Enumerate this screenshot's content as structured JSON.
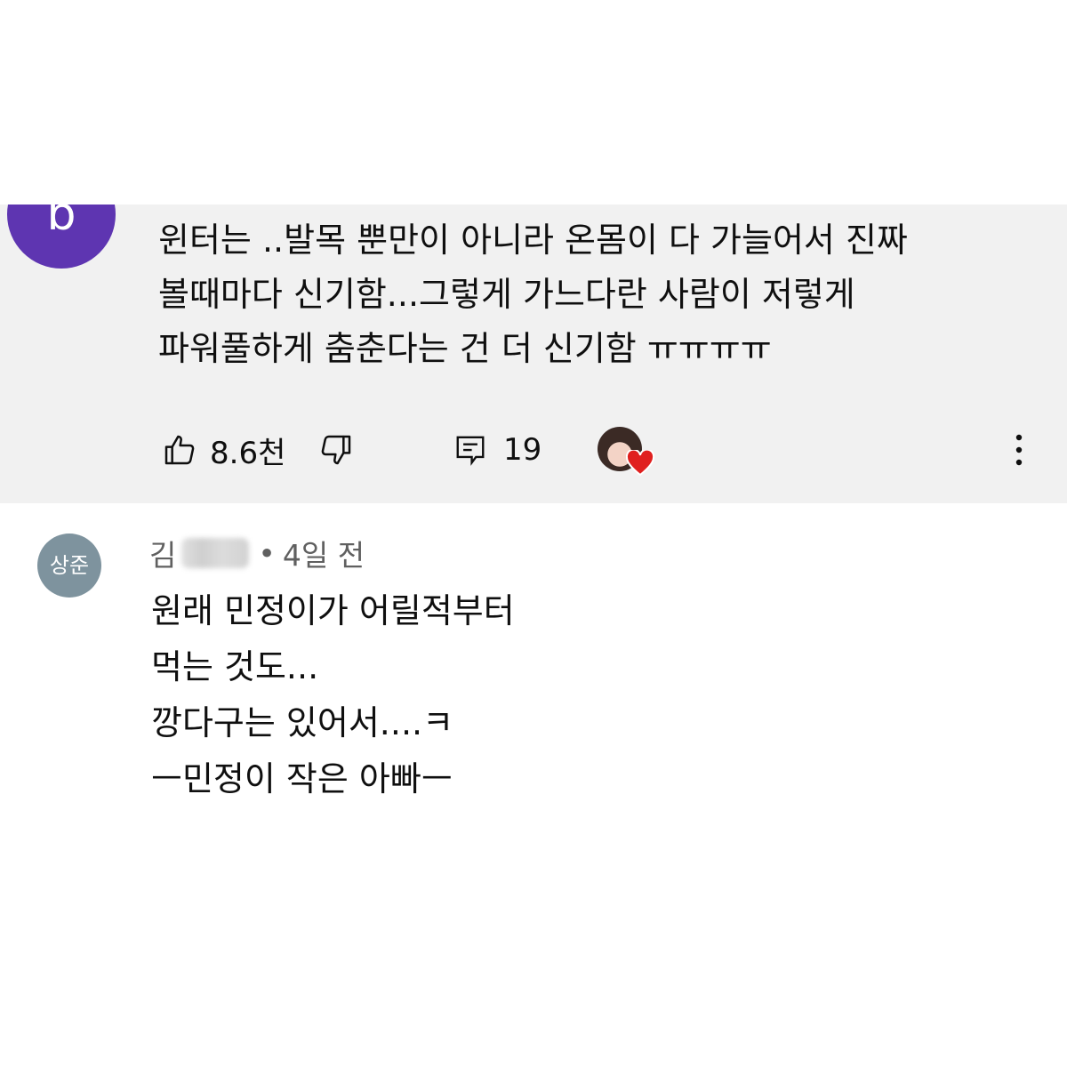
{
  "comment_1": {
    "avatar_letter": "b",
    "lines": [
      "윈터는 ..발목 뿐만이 아니라 온몸이 다 가늘어서 진짜",
      "볼때마다 신기함...그렇게 가느다란 사람이 저렇게",
      "파워풀하게 춤춘다는 건 더 신기함  ㅠㅠㅠㅠ"
    ],
    "like_count": "8.6천",
    "reply_count": "19",
    "icons": {
      "like": "thumbs-up-icon",
      "dislike": "thumbs-down-icon",
      "reply": "comment-icon",
      "creator_heart": "heart-icon",
      "more": "more-vert-icon"
    },
    "colors": {
      "background": "#f1f1f1",
      "avatar": "#5e35b1",
      "heart": "#e0201f"
    }
  },
  "comment_2": {
    "avatar_text": "상준",
    "author_visible": "김",
    "separator": "•",
    "time": "4일 전",
    "lines": [
      "원래 민정이가 어릴적부터",
      "먹는 것도...",
      "깡다구는 있어서....ㅋ",
      "ㅡ민정이 작은 아빠ㅡ"
    ],
    "colors": {
      "avatar": "#7e939e",
      "meta_text": "#606060"
    }
  }
}
